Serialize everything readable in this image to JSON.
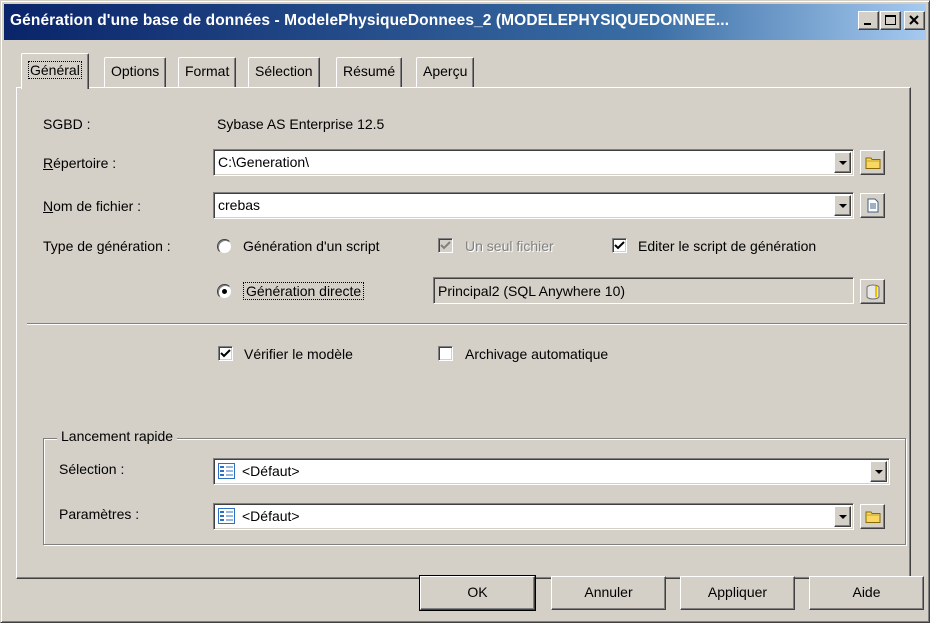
{
  "window": {
    "title": "Génération d'une base de données - ModelePhysiqueDonnees_2 (MODELEPHYSIQUEDONNEE...",
    "controls": [
      "_",
      "□",
      "×"
    ]
  },
  "tabs": [
    {
      "label": "Général",
      "active": true
    },
    {
      "label": "Options"
    },
    {
      "label": "Format"
    },
    {
      "label": "Sélection"
    },
    {
      "label": "Résumé"
    },
    {
      "label": "Aperçu"
    }
  ],
  "general": {
    "sgbd_label": "SGBD :",
    "sgbd_value": "Sybase AS Enterprise 12.5",
    "repertoire_label": "Répertoire :",
    "repertoire_value": "C:\\Generation\\",
    "nomfichier_label": "Nom de fichier :",
    "nomfichier_value": "crebas",
    "type_label": "Type de génération :",
    "radio_script_label": "Génération d'un script",
    "radio_direct_label": "Génération directe",
    "selected_type": "Génération directe",
    "un_seul_fichier_label": "Un seul fichier",
    "un_seul_fichier_checked": true,
    "un_seul_fichier_enabled": false,
    "editer_script_label": "Editer le script de génération",
    "editer_script_checked": true,
    "connection_value": "Principal2 (SQL Anywhere 10)",
    "verifier_label": "Vérifier le modèle",
    "verifier_checked": true,
    "archivage_label": "Archivage automatique",
    "archivage_checked": false
  },
  "lancement": {
    "title": "Lancement rapide",
    "selection_label": "Sélection :",
    "selection_value": "<Défaut>",
    "parametres_label": "Paramètres :",
    "parametres_value": "<Défaut>"
  },
  "buttons": {
    "ok": "OK",
    "annuler": "Annuler",
    "appliquer": "Appliquer",
    "aide": "Aide"
  },
  "colors": {
    "face": "#d4d0c8",
    "title_start": "#0a246a",
    "title_end": "#a6caf0"
  },
  "icons": {
    "folder": "folder-icon",
    "file": "file-icon",
    "database": "database-icon",
    "list": "list-icon"
  }
}
